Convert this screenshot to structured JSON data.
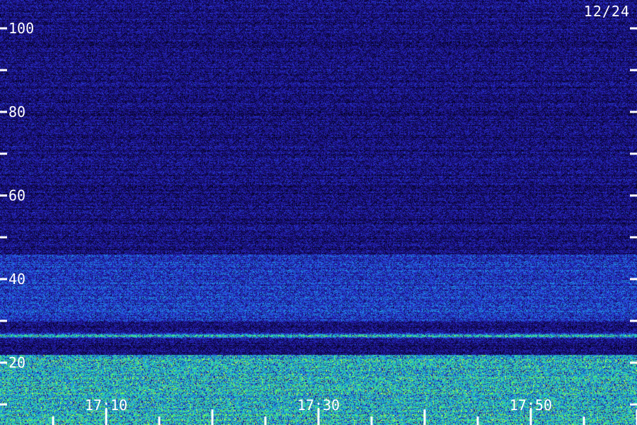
{
  "date": "12/24",
  "chart_data": {
    "type": "heatmap",
    "title": "",
    "xlabel": "",
    "ylabel": "",
    "x_tick_labels": [
      "17:10",
      "17:30",
      "17:50"
    ],
    "x_minute_range": [
      1700,
      1800
    ],
    "x_labeled_minutes": [
      1710,
      1730,
      1750
    ],
    "x_tick_step_minutes": 5,
    "y_range": [
      0,
      105
    ],
    "y_tick_labels": [
      "20",
      "40",
      "60",
      "80",
      "100"
    ],
    "y_labeled_values": [
      20,
      40,
      60,
      80,
      100
    ],
    "y_tick_step": 10,
    "grid": false,
    "colormap": [
      "#000010",
      "#1a0f7a",
      "#2a2ad0",
      "#1e88e8",
      "#20d0c0",
      "#7cff30",
      "#ffff40"
    ],
    "features": [
      {
        "name": "dense band",
        "y_range": [
          0,
          22
        ],
        "intensity": 0.62
      },
      {
        "name": "narrow line",
        "y": 26.5,
        "intensity": 0.78
      },
      {
        "name": "lighter band",
        "y_range": [
          30,
          46
        ],
        "intensity": 0.38
      },
      {
        "name": "background",
        "y_range": [
          46,
          105
        ],
        "intensity": 0.2
      }
    ]
  }
}
